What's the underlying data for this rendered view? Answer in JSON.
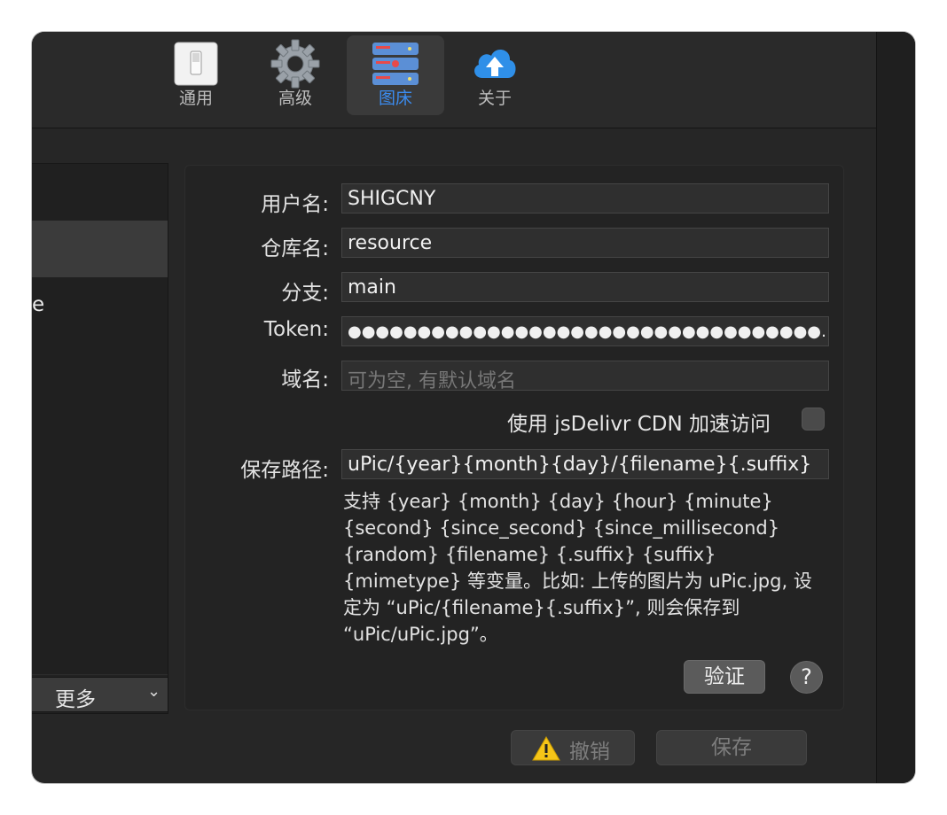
{
  "toolbar": {
    "tabs": [
      {
        "label": "通用",
        "icon": "switch-icon"
      },
      {
        "label": "高级",
        "icon": "gear-icon"
      },
      {
        "label": "图床",
        "icon": "server-icon"
      },
      {
        "label": "关于",
        "icon": "cloud-upload-icon"
      }
    ],
    "active_tab": "图床",
    "active_color": "#3b8cf0"
  },
  "sidebar": {
    "rows": [
      "",
      "",
      "e",
      "",
      "",
      "",
      "",
      "",
      ""
    ],
    "selected_index": 1,
    "more_label": "更多",
    "more_chevron": "⌄"
  },
  "form": {
    "username": {
      "label": "用户名:",
      "value": "SHIGCNY"
    },
    "repo": {
      "label": "仓库名:",
      "value": "resource"
    },
    "branch": {
      "label": "分支:",
      "value": "main"
    },
    "token": {
      "label": "Token:",
      "value": "●●●●●●●●●●●●●●●●●●●●●●●●●●●●●●●●●●…"
    },
    "domain": {
      "label": "域名:",
      "placeholder": "可为空, 有默认域名"
    },
    "cdn_label": "使用 jsDelivr CDN 加速访问",
    "cdn_checked": false,
    "save_path": {
      "label": "保存路径:",
      "value": "uPic/{year}{month}{day}/{filename}{.suffix}"
    },
    "help_text": "支持 {year} {month} {day} {hour} {minute} {second} {since_second} {since_millisecond} {random} {filename} {.suffix} {suffix} {mimetype} 等变量。比如: 上传的图片为 uPic.jpg, 设定为 “uPic/{filename}{.suffix}”, 则会保存到 “uPic/uPic.jpg”。",
    "verify_label": "验证",
    "help_button": "?"
  },
  "footer": {
    "undo_label": "撤销",
    "save_label": "保存"
  }
}
